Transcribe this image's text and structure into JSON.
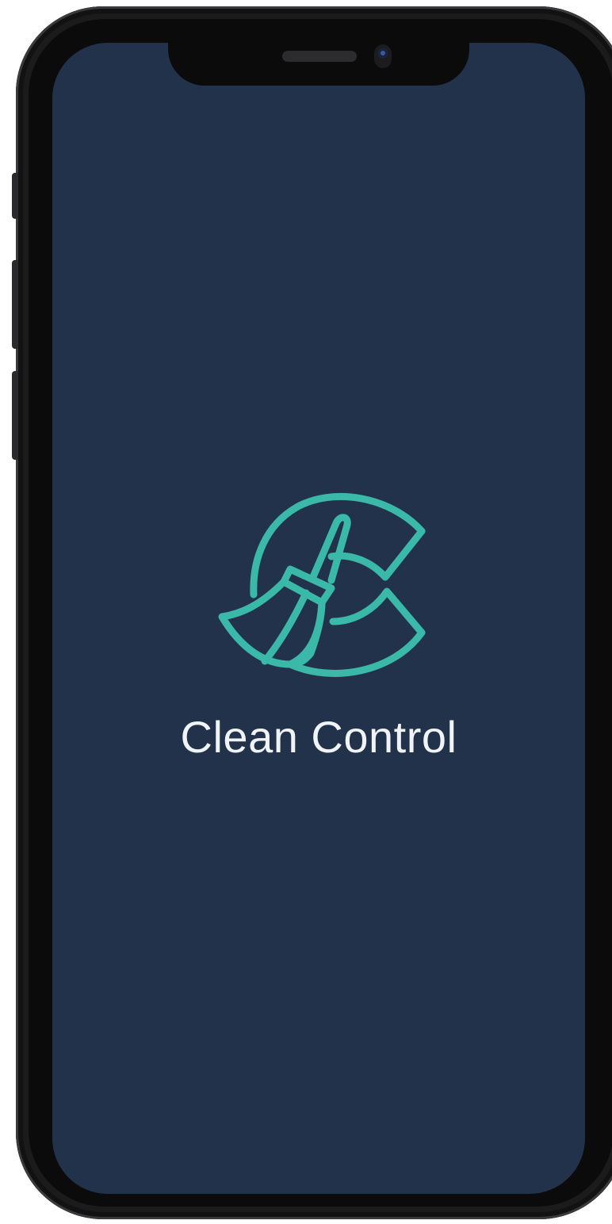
{
  "splash": {
    "app_name": "Clean Control",
    "logo_icon": "broom-c-logo-icon"
  },
  "colors": {
    "background": "#22324b",
    "logo": "#3ab8a8",
    "title": "#f0f4f7",
    "device_frame": "#1b1b1c"
  }
}
